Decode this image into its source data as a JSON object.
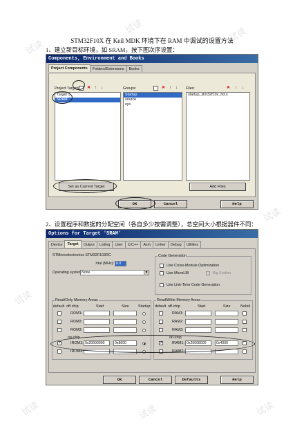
{
  "doc": {
    "title": "STM32F10X 在 Keil MDK 环境下在 RAM 中调试的设置方法",
    "step1": "1、建立新目标环境，如 SRAM，按下图次序设置：",
    "step2": "2、设置程序和数据的分配空间（各自多少按需调整），总空间大小根据器件不同："
  },
  "watermark": "试读",
  "dialog1": {
    "title": "Components, Environment and Books",
    "tabs": [
      "Project Components",
      "Folders/Extensions",
      "Books"
    ],
    "targets": {
      "label": "Project Targets:",
      "items": [
        "Target 1",
        "SRAM"
      ],
      "selected": 1
    },
    "groups": {
      "label": "Groups:",
      "items": [
        "Startup",
        "source",
        "sys"
      ],
      "selected": 0
    },
    "files": {
      "label": "Files:",
      "items": [
        "startup_stm32f10x_hd.s"
      ]
    },
    "set_current_target": "Set as Current Target",
    "add_files": "Add Files",
    "ok": "OK",
    "cancel": "Cancel",
    "help": "Help",
    "icons": {
      "new": "new-icon",
      "delete": "delete-x-icon",
      "up": "arrow-up-icon",
      "down": "arrow-down-icon"
    }
  },
  "dialog2": {
    "title": "Options for Target 'SRAM'",
    "tabs": [
      "Device",
      "Target",
      "Output",
      "Listing",
      "User",
      "C/C++",
      "Asm",
      "Linker",
      "Debug",
      "Utilities"
    ],
    "device_name": "STMicroelectronics STM32F103RC",
    "xtal_label": "Xtal (MHz):",
    "xtal_value": "8.0",
    "os_label": "Operating system:",
    "os_value": "None",
    "code_gen": {
      "title": "Code Generation",
      "cross_module": "Use Cross-Module Optimization",
      "microlib": "Use MicroLIB",
      "big_endian": "Big Endian",
      "link_time": "Use Link-Time Code Generation"
    },
    "rom_area": {
      "title": "Read/Only Memory Areas",
      "headers": [
        "default",
        "off-chip",
        "Start",
        "Size",
        "Startup"
      ],
      "rows": [
        "ROM1:",
        "ROM2:",
        "ROM3:"
      ],
      "onchip_label": "on-chip",
      "irom": {
        "name": "IROM1:",
        "start": "0x20000000",
        "size": "0x8000"
      }
    },
    "ram_area": {
      "title": "Read/Write Memory Areas",
      "headers": [
        "default",
        "off-chip",
        "Start",
        "Size",
        "NoInit"
      ],
      "rows": [
        "RAM1:",
        "RAM2:",
        "RAM3:"
      ],
      "onchip_label": "on-chip",
      "iram": {
        "name": "IRAM1:",
        "start": "0x20008000",
        "size": "0x4000"
      }
    },
    "ok": "OK",
    "cancel": "Cancel",
    "defaults": "Defaults",
    "help": "Help"
  }
}
